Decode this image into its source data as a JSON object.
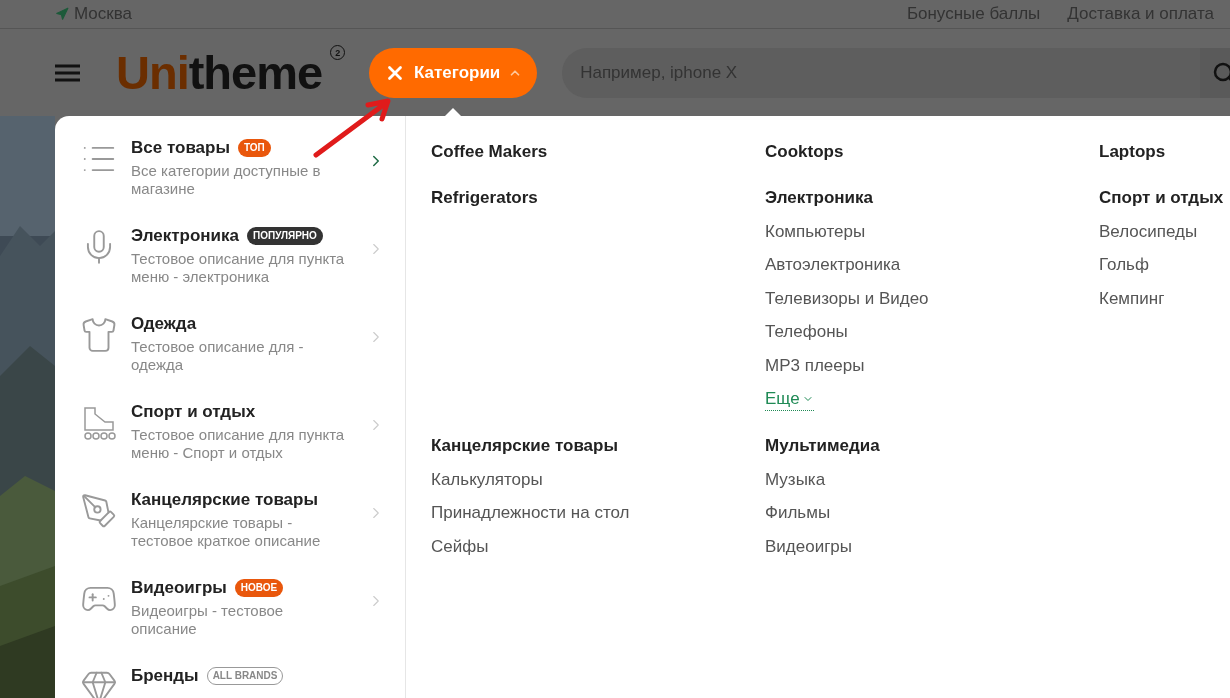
{
  "topbar": {
    "location": "Москва",
    "links": [
      "Бонусные баллы",
      "Доставка и оплата"
    ]
  },
  "header": {
    "logo": {
      "accent": "Uni",
      "rest": "theme",
      "mark": "2"
    },
    "catalog_button": {
      "label": "Категории",
      "expanded": true
    },
    "search": {
      "placeholder": "Например, iphone X"
    }
  },
  "menu": [
    {
      "kind": "list",
      "title": "Все товары",
      "badge": {
        "text": "ТОП",
        "kind": "accent"
      },
      "description": "Все категории доступные в магазине",
      "selected": true
    },
    {
      "kind": "mic",
      "title": "Электроника",
      "badge": {
        "text": "ПОПУЛЯРНО",
        "kind": "dark"
      },
      "description": "Тестовое описание для пункта меню - электроника",
      "selected": false
    },
    {
      "kind": "shirt",
      "title": "Одежда",
      "description": "Тестовое описание для - одежда",
      "selected": false
    },
    {
      "kind": "skate",
      "title": "Спорт и отдых",
      "description": "Тестовое описание для пункта меню - Спорт и отдых",
      "selected": false
    },
    {
      "kind": "pen",
      "title": "Канцелярские товары",
      "description": "Канцелярские товары - тестовое краткое описание",
      "selected": false
    },
    {
      "kind": "gamepad",
      "title": "Видеоигры",
      "badge": {
        "text": "НОВОЕ",
        "kind": "accent"
      },
      "description": "Видеоигры - тестовое описание",
      "selected": false
    },
    {
      "kind": "gem",
      "title": "Бренды",
      "badge": {
        "text": "ALL BRANDS",
        "kind": "outline"
      }
    }
  ],
  "category_rows": [
    [
      {
        "title": "Coffee Makers"
      },
      {
        "title": "Cooktops"
      },
      {
        "title": "Laptops"
      }
    ],
    [
      {
        "title": "Refrigerators"
      },
      {
        "title": "Электроника",
        "items": [
          "Компьютеры",
          "Автоэлектроника",
          "Телевизоры и Видео",
          "Телефоны",
          "MP3 плееры"
        ],
        "more": "Еще"
      },
      {
        "title": "Спорт и отдых",
        "items": [
          "Велосипеды",
          "Гольф",
          "Кемпинг"
        ]
      }
    ],
    [
      {
        "title": "Канцелярские товары",
        "items": [
          "Калькуляторы",
          "Принадлежности на стол",
          "Сейфы"
        ]
      },
      {
        "title": "Мультимедиа",
        "items": [
          "Музыка",
          "Фильмы",
          "Видеоигры"
        ]
      }
    ]
  ]
}
